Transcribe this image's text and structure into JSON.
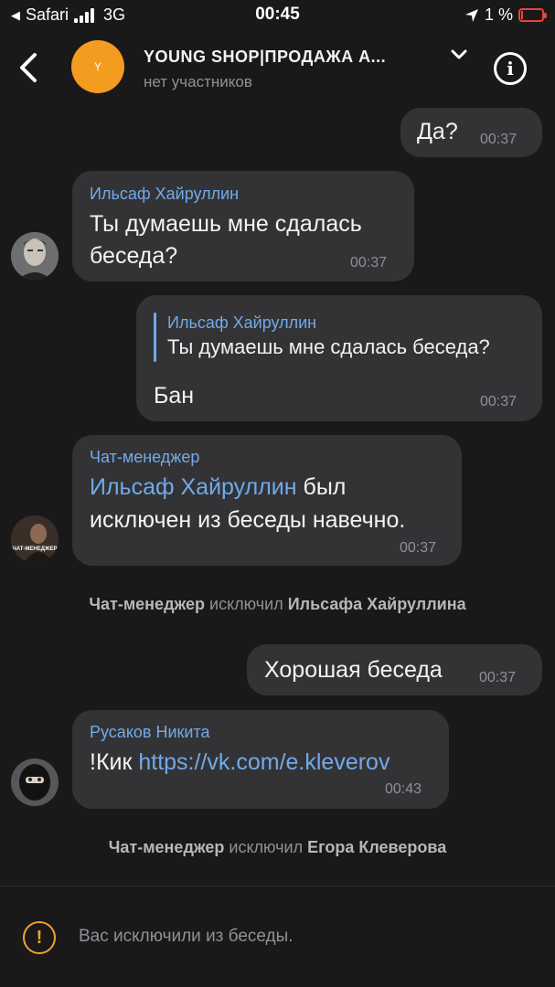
{
  "status_bar": {
    "back_app": "Safari",
    "network": "3G",
    "time": "00:45",
    "battery": "1 %"
  },
  "header": {
    "avatar_letter": "Y",
    "title": "YOUNG SHOP|ПРОДАЖА А...",
    "subtitle": "нет участников",
    "info_glyph": "i"
  },
  "messages": [
    {
      "text": "Да?",
      "time": "00:37"
    },
    {
      "author": "Ильсаф Хайруллин",
      "text_line1": "Ты думаешь мне сдалась",
      "text_line2": "беседа?",
      "time": "00:37"
    },
    {
      "reply_author": "Ильсаф Хайруллин",
      "reply_text": "Ты думаешь мне сдалась беседа?",
      "text": "Бан",
      "time": "00:37"
    },
    {
      "author": "Чат-менеджер",
      "mention": "Ильсаф Хайруллин",
      "text_line1_rest": " был",
      "text_line2": "исключен из беседы навечно.",
      "time": "00:37",
      "avatar_caption": "ЧАТ-МЕНЕДЖЕР"
    },
    {
      "text": "Хорошая беседа",
      "time": "00:37"
    },
    {
      "author": "Русаков Никита",
      "prefix": "!Кик ",
      "link": "https://vk.com/e.kleverov",
      "time": "00:43"
    }
  ],
  "service": [
    {
      "actor": "Чат-менеджер",
      "verb": " исключил ",
      "target": "Ильсафа Хайруллина"
    },
    {
      "actor": "Чат-менеджер",
      "verb": " исключил ",
      "target": "Егора Клеверова"
    }
  ],
  "footer": {
    "icon": "!",
    "text": "Вас исключили из беседы."
  },
  "colors": {
    "background": "#19191a",
    "bubble": "#333335",
    "accent_link": "#71aaeb",
    "avatar_orange": "#f39c1f",
    "warning": "#f1a02e",
    "battery_low": "#e8433f"
  }
}
